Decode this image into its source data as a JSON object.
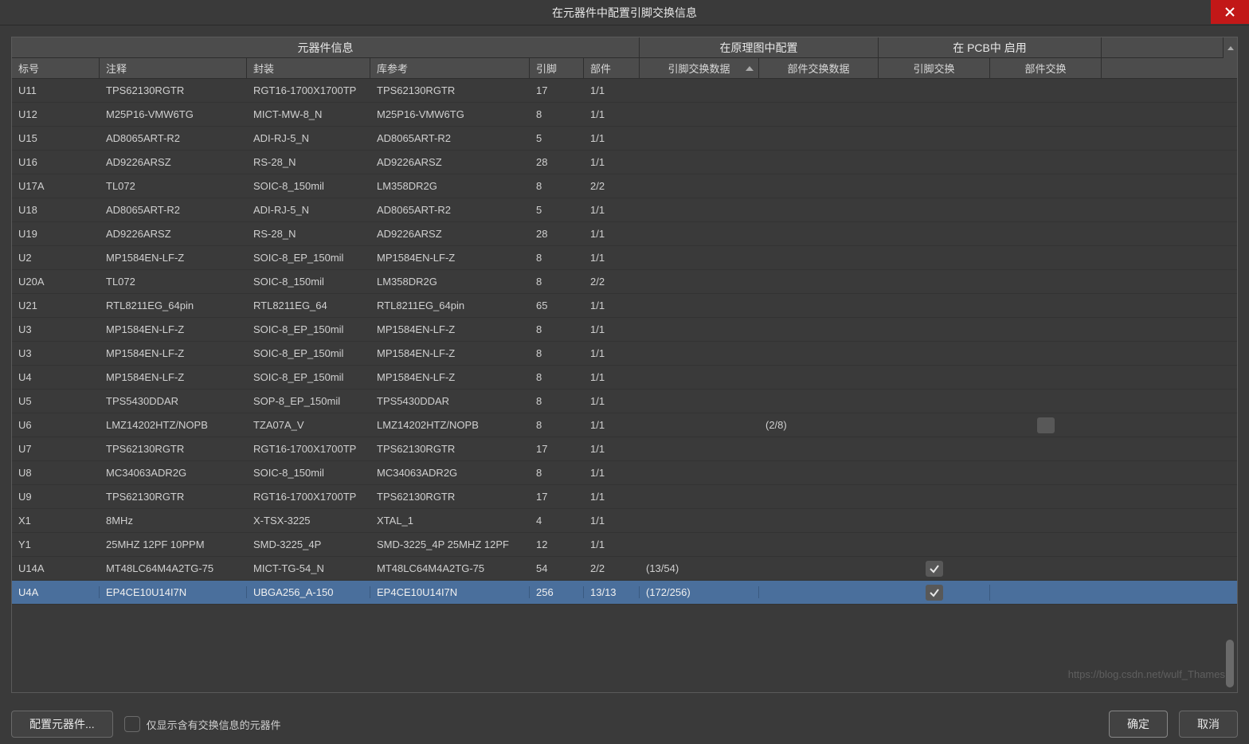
{
  "window": {
    "title": "在元器件中配置引脚交换信息"
  },
  "group_headers": {
    "component_info": "元器件信息",
    "schematic_config": "在原理图中配置",
    "pcb_enable": "在 PCB中 启用"
  },
  "columns": {
    "designator": "标号",
    "comment": "注释",
    "footprint": "封装",
    "library_ref": "库参考",
    "pins": "引脚",
    "parts": "部件",
    "pin_swap_data": "引脚交换数据",
    "part_swap_data": "部件交换数据",
    "pin_swap": "引脚交换",
    "part_swap": "部件交换"
  },
  "rows": [
    {
      "des": "U11",
      "com": "TPS62130RGTR",
      "fp": "RGT16-1700X1700TP",
      "lib": "TPS62130RGTR",
      "pin": "17",
      "part": "1/1",
      "pind": "",
      "partd": "",
      "pswp": "",
      "ptswp": ""
    },
    {
      "des": "U12",
      "com": "M25P16-VMW6TG",
      "fp": "MICT-MW-8_N",
      "lib": "M25P16-VMW6TG",
      "pin": "8",
      "part": "1/1",
      "pind": "",
      "partd": "",
      "pswp": "",
      "ptswp": ""
    },
    {
      "des": "U15",
      "com": "AD8065ART-R2",
      "fp": "ADI-RJ-5_N",
      "lib": "AD8065ART-R2",
      "pin": "5",
      "part": "1/1",
      "pind": "",
      "partd": "",
      "pswp": "",
      "ptswp": ""
    },
    {
      "des": "U16",
      "com": "AD9226ARSZ",
      "fp": "RS-28_N",
      "lib": "AD9226ARSZ",
      "pin": "28",
      "part": "1/1",
      "pind": "",
      "partd": "",
      "pswp": "",
      "ptswp": ""
    },
    {
      "des": "U17A",
      "com": "TL072",
      "fp": "SOIC-8_150mil",
      "lib": "LM358DR2G",
      "pin": "8",
      "part": "2/2",
      "pind": "",
      "partd": "",
      "pswp": "",
      "ptswp": ""
    },
    {
      "des": "U18",
      "com": "AD8065ART-R2",
      "fp": "ADI-RJ-5_N",
      "lib": "AD8065ART-R2",
      "pin": "5",
      "part": "1/1",
      "pind": "",
      "partd": "",
      "pswp": "",
      "ptswp": ""
    },
    {
      "des": "U19",
      "com": "AD9226ARSZ",
      "fp": "RS-28_N",
      "lib": "AD9226ARSZ",
      "pin": "28",
      "part": "1/1",
      "pind": "",
      "partd": "",
      "pswp": "",
      "ptswp": ""
    },
    {
      "des": "U2",
      "com": "MP1584EN-LF-Z",
      "fp": "SOIC-8_EP_150mil",
      "lib": "MP1584EN-LF-Z",
      "pin": "8",
      "part": "1/1",
      "pind": "",
      "partd": "",
      "pswp": "",
      "ptswp": ""
    },
    {
      "des": "U20A",
      "com": "TL072",
      "fp": "SOIC-8_150mil",
      "lib": "LM358DR2G",
      "pin": "8",
      "part": "2/2",
      "pind": "",
      "partd": "",
      "pswp": "",
      "ptswp": ""
    },
    {
      "des": "U21",
      "com": "RTL8211EG_64pin",
      "fp": "RTL8211EG_64",
      "lib": "RTL8211EG_64pin",
      "pin": "65",
      "part": "1/1",
      "pind": "",
      "partd": "",
      "pswp": "",
      "ptswp": ""
    },
    {
      "des": "U3",
      "com": "MP1584EN-LF-Z",
      "fp": "SOIC-8_EP_150mil",
      "lib": "MP1584EN-LF-Z",
      "pin": "8",
      "part": "1/1",
      "pind": "",
      "partd": "",
      "pswp": "",
      "ptswp": ""
    },
    {
      "des": "U3",
      "com": "MP1584EN-LF-Z",
      "fp": "SOIC-8_EP_150mil",
      "lib": "MP1584EN-LF-Z",
      "pin": "8",
      "part": "1/1",
      "pind": "",
      "partd": "",
      "pswp": "",
      "ptswp": ""
    },
    {
      "des": "U4",
      "com": "MP1584EN-LF-Z",
      "fp": "SOIC-8_EP_150mil",
      "lib": "MP1584EN-LF-Z",
      "pin": "8",
      "part": "1/1",
      "pind": "",
      "partd": "",
      "pswp": "",
      "ptswp": ""
    },
    {
      "des": "U5",
      "com": "TPS5430DDAR",
      "fp": "SOP-8_EP_150mil",
      "lib": "TPS5430DDAR",
      "pin": "8",
      "part": "1/1",
      "pind": "",
      "partd": "",
      "pswp": "",
      "ptswp": ""
    },
    {
      "des": "U6",
      "com": "LMZ14202HTZ/NOPB",
      "fp": "TZA07A_V",
      "lib": "LMZ14202HTZ/NOPB",
      "pin": "8",
      "part": "1/1",
      "pind": "",
      "partd": "(2/8)",
      "pswp": "",
      "ptswp": "box"
    },
    {
      "des": "U7",
      "com": "TPS62130RGTR",
      "fp": "RGT16-1700X1700TP",
      "lib": "TPS62130RGTR",
      "pin": "17",
      "part": "1/1",
      "pind": "",
      "partd": "",
      "pswp": "",
      "ptswp": ""
    },
    {
      "des": "U8",
      "com": "MC34063ADR2G",
      "fp": "SOIC-8_150mil",
      "lib": "MC34063ADR2G",
      "pin": "8",
      "part": "1/1",
      "pind": "",
      "partd": "",
      "pswp": "",
      "ptswp": ""
    },
    {
      "des": "U9",
      "com": "TPS62130RGTR",
      "fp": "RGT16-1700X1700TP",
      "lib": "TPS62130RGTR",
      "pin": "17",
      "part": "1/1",
      "pind": "",
      "partd": "",
      "pswp": "",
      "ptswp": ""
    },
    {
      "des": "X1",
      "com": "8MHz",
      "fp": "X-TSX-3225",
      "lib": "XTAL_1",
      "pin": "4",
      "part": "1/1",
      "pind": "",
      "partd": "",
      "pswp": "",
      "ptswp": ""
    },
    {
      "des": "Y1",
      "com": "25MHZ 12PF 10PPM",
      "fp": "SMD-3225_4P",
      "lib": "SMD-3225_4P  25MHZ 12PF",
      "pin": "12",
      "part": "1/1",
      "pind": "",
      "partd": "",
      "pswp": "",
      "ptswp": ""
    },
    {
      "des": "U14A",
      "com": "MT48LC64M4A2TG-75",
      "fp": "MICT-TG-54_N",
      "lib": "MT48LC64M4A2TG-75",
      "pin": "54",
      "part": "2/2",
      "pind": "(13/54)",
      "partd": "",
      "pswp": "check",
      "ptswp": ""
    },
    {
      "des": "U4A",
      "com": "EP4CE10U14I7N",
      "fp": "UBGA256_A-150",
      "lib": "EP4CE10U14I7N",
      "pin": "256",
      "part": "13/13",
      "pind": "(172/256)",
      "partd": "",
      "pswp": "check",
      "ptswp": "",
      "selected": true
    }
  ],
  "footer": {
    "configure_button": "配置元器件...",
    "show_only_swap_label": "仅显示含有交换信息的元器件",
    "ok_button": "确定",
    "cancel_button": "取消"
  },
  "watermark": "https://blog.csdn.net/wulf_Thames"
}
